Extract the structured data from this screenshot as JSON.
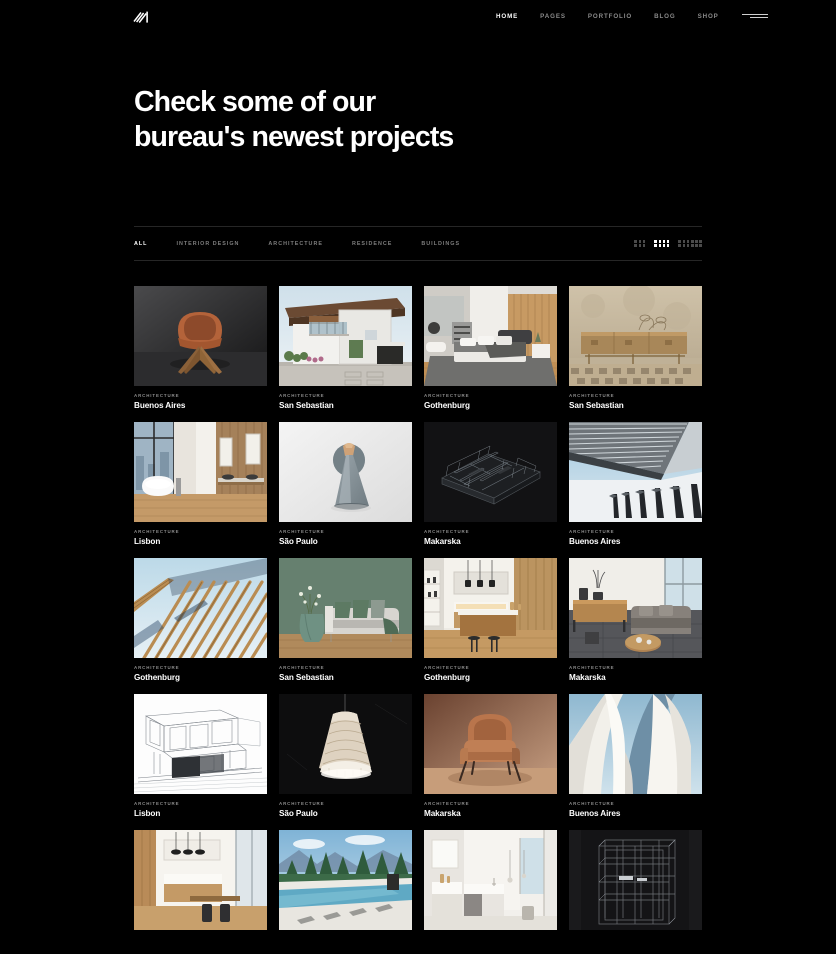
{
  "brand": {
    "logo_icon": "n-monogram-logo",
    "logo_alt": "N"
  },
  "nav": {
    "items": [
      {
        "label": "HOME",
        "active": true
      },
      {
        "label": "PAGES",
        "active": false
      },
      {
        "label": "PORTFOLIO",
        "active": false
      },
      {
        "label": "BLOG",
        "active": false
      },
      {
        "label": "SHOP",
        "active": false
      }
    ],
    "menu_icon": "hamburger-menu-icon"
  },
  "hero": {
    "line1": "Check some of our",
    "line2": "bureau's newest projects"
  },
  "filters": {
    "items": [
      {
        "label": "ALL",
        "active": true
      },
      {
        "label": "INTERIOR DESIGN",
        "active": false
      },
      {
        "label": "ARCHITECTURE",
        "active": false
      },
      {
        "label": "RESIDENCE",
        "active": false
      },
      {
        "label": "BUILDINGS",
        "active": false
      }
    ]
  },
  "layout_toggles": [
    {
      "name": "grid-3-columns",
      "columns": 3,
      "active": false
    },
    {
      "name": "grid-4-columns",
      "columns": 4,
      "active": true
    },
    {
      "name": "grid-6-columns",
      "columns": 6,
      "active": false
    }
  ],
  "colors": {
    "background": "#000000",
    "text_primary": "#ffffff",
    "text_muted": "#8a8a8a",
    "divider": "#262626"
  },
  "projects": [
    {
      "category": "ARCHITECTURE",
      "title": "Buenos Aires",
      "image": "tan-shell-chair-dark-studio"
    },
    {
      "category": "ARCHITECTURE",
      "title": "San Sebastian",
      "image": "modern-white-house-exterior"
    },
    {
      "category": "ARCHITECTURE",
      "title": "Gothenburg",
      "image": "grey-bedroom-wood-panel"
    },
    {
      "category": "ARCHITECTURE",
      "title": "San Sebastian",
      "image": "wood-sideboard-beige-wall"
    },
    {
      "category": "ARCHITECTURE",
      "title": "Lisbon",
      "image": "bathroom-tub-city-window"
    },
    {
      "category": "ARCHITECTURE",
      "title": "São Paulo",
      "image": "grey-cone-wall-lamp"
    },
    {
      "category": "ARCHITECTURE",
      "title": "Makarska",
      "image": "dark-3d-floorplan-wireframe"
    },
    {
      "category": "ARCHITECTURE",
      "title": "Buenos Aires",
      "image": "louvered-facade-sky"
    },
    {
      "category": "ARCHITECTURE",
      "title": "Gothenburg",
      "image": "wood-slat-canopy-sky"
    },
    {
      "category": "ARCHITECTURE",
      "title": "San Sebastian",
      "image": "green-wall-sofa-living-room"
    },
    {
      "category": "ARCHITECTURE",
      "title": "Gothenburg",
      "image": "kitchen-island-pendants"
    },
    {
      "category": "ARCHITECTURE",
      "title": "Makarska",
      "image": "living-room-sideboard-window"
    },
    {
      "category": "ARCHITECTURE",
      "title": "Lisbon",
      "image": "architectural-line-sketch"
    },
    {
      "category": "ARCHITECTURE",
      "title": "São Paulo",
      "image": "pleated-pendant-lamp-dark"
    },
    {
      "category": "ARCHITECTURE",
      "title": "Makarska",
      "image": "terracotta-armchair"
    },
    {
      "category": "ARCHITECTURE",
      "title": "Buenos Aires",
      "image": "white-curved-forms-sky"
    },
    {
      "category": "",
      "title": "",
      "image": "kitchen-wood-warm-daylight"
    },
    {
      "category": "",
      "title": "",
      "image": "infinity-pool-mountain-view"
    },
    {
      "category": "",
      "title": "",
      "image": "white-minimal-kitchen"
    },
    {
      "category": "",
      "title": "",
      "image": "black-wire-shelving-unit"
    }
  ]
}
